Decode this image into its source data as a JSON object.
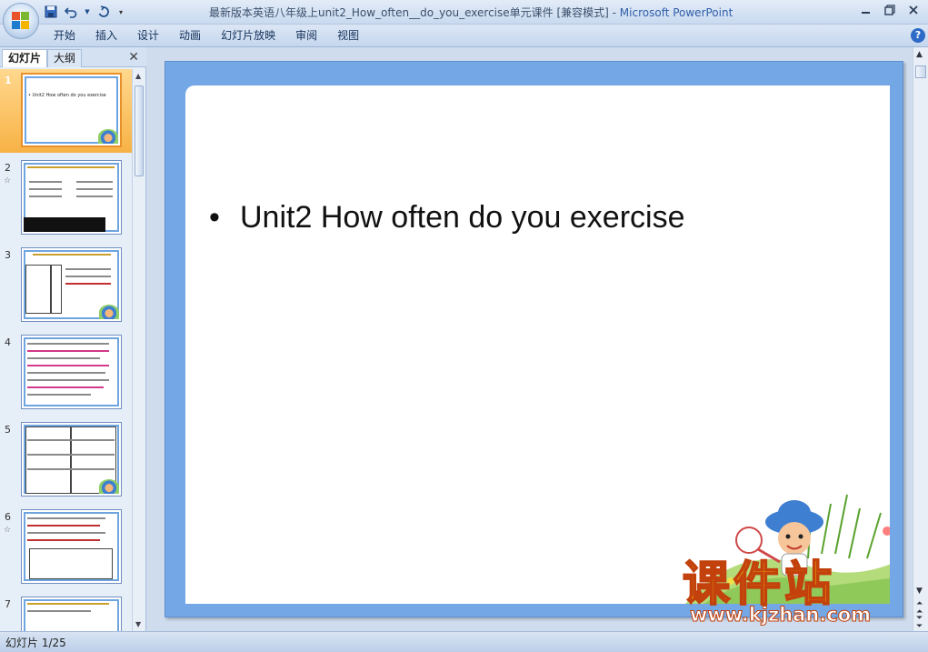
{
  "window": {
    "title": "最新版本英语八年级上unit2_How_often__do_you_exercise单元课件 [兼容模式]",
    "separator": " - ",
    "app_name": "Microsoft PowerPoint"
  },
  "quick_access": [
    "save-icon",
    "undo-icon",
    "redo-icon",
    "customize-icon"
  ],
  "ribbon": {
    "tabs": [
      "开始",
      "插入",
      "设计",
      "动画",
      "幻灯片放映",
      "审阅",
      "视图"
    ]
  },
  "panel": {
    "tab_slides": "幻灯片",
    "tab_outline": "大纲",
    "close": "✕"
  },
  "thumbnails": [
    {
      "num": "1",
      "text": "• Unit2 How often do you exercise",
      "selected": true,
      "anim": false
    },
    {
      "num": "2",
      "text": "",
      "selected": false,
      "anim": true
    },
    {
      "num": "3",
      "text": "",
      "selected": false,
      "anim": false
    },
    {
      "num": "4",
      "text": "",
      "selected": false,
      "anim": false
    },
    {
      "num": "5",
      "text": "",
      "selected": false,
      "anim": false
    },
    {
      "num": "6",
      "text": "",
      "selected": false,
      "anim": true
    },
    {
      "num": "7",
      "text": "",
      "selected": false,
      "anim": false
    }
  ],
  "slide": {
    "bullet_symbol": "•",
    "bullet_text": "Unit2 How often do you exercise",
    "watermark_cn": "课件站",
    "watermark_url": "www.kjzhan.com"
  },
  "status": {
    "slide_counter": "幻灯片 1/25"
  },
  "colors": {
    "slide_border": "#74a7e6",
    "selected_thumb": "#f7b245",
    "watermark_fill": "#ffe600",
    "watermark_stroke": "#c2410c"
  }
}
